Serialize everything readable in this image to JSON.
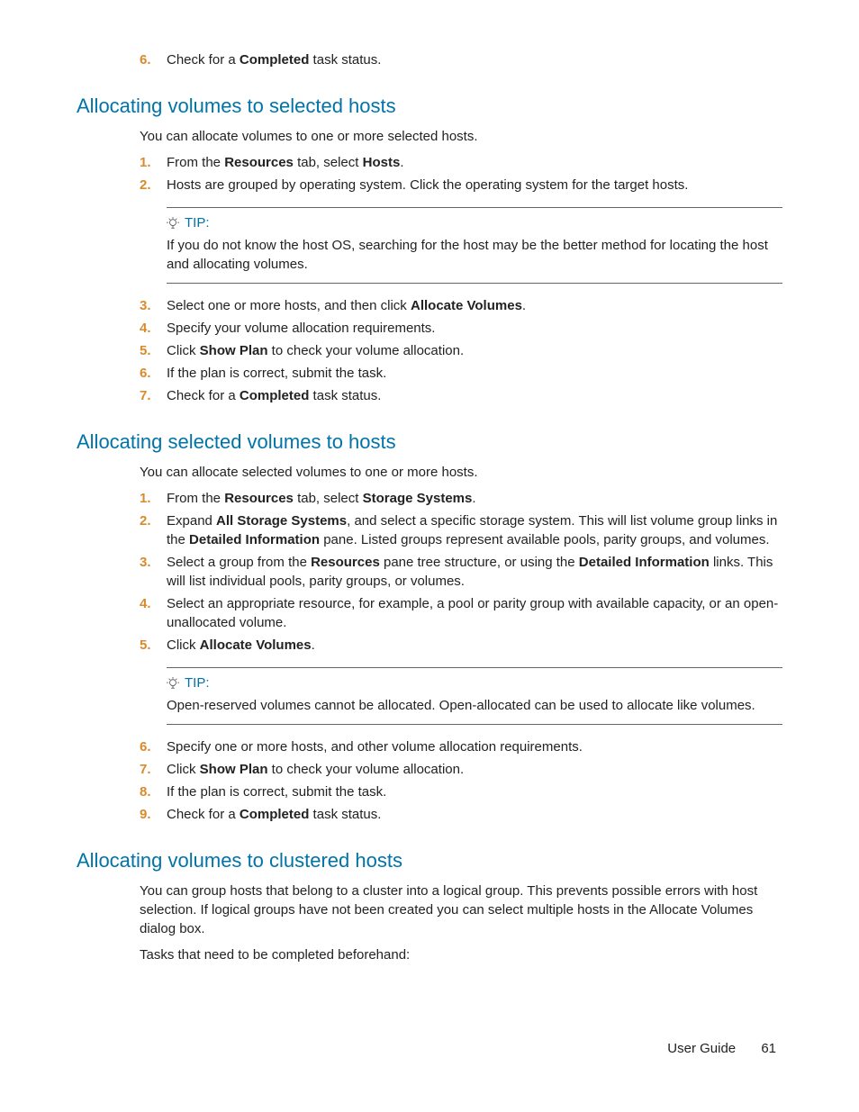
{
  "intro_step": {
    "num": "6.",
    "pre": "Check for a ",
    "bold": "Completed",
    "post": " task status."
  },
  "sec1": {
    "heading": "Allocating volumes to selected hosts",
    "lead": "You can allocate volumes to one or more selected hosts.",
    "steps_a": [
      {
        "num": "1.",
        "pre": "From the ",
        "b1": "Resources",
        "mid": " tab, select ",
        "b2": "Hosts",
        "post": "."
      },
      {
        "num": "2.",
        "pre": "Hosts are grouped by operating system. Click the operating system for the target hosts."
      }
    ],
    "tip": {
      "label": "TIP:",
      "body": "If you do not know the host OS, searching for the host may be the better method for locating the host and allocating volumes."
    },
    "steps_b": [
      {
        "num": "3.",
        "pre": "Select one or more hosts, and then click ",
        "b1": "Allocate Volumes",
        "post": "."
      },
      {
        "num": "4.",
        "pre": "Specify your volume allocation requirements."
      },
      {
        "num": "5.",
        "pre": "Click ",
        "b1": "Show Plan",
        "post": " to check your volume allocation."
      },
      {
        "num": "6.",
        "pre": "If the plan is correct, submit the task."
      },
      {
        "num": "7.",
        "pre": "Check for a ",
        "b1": "Completed",
        "post": " task status."
      }
    ]
  },
  "sec2": {
    "heading": "Allocating selected volumes to hosts",
    "lead": "You can allocate selected volumes to one or more hosts.",
    "steps_a": [
      {
        "num": "1.",
        "pre": "From the ",
        "b1": "Resources",
        "mid": " tab, select ",
        "b2": "Storage Systems",
        "post": "."
      },
      {
        "num": "2.",
        "pre": "Expand ",
        "b1": "All Storage Systems",
        "mid": ", and select a specific storage system. This will list volume group links in the ",
        "b2": "Detailed Information",
        "post": " pane. Listed groups represent available pools, parity groups, and volumes."
      },
      {
        "num": "3.",
        "pre": "Select a group from the ",
        "b1": "Resources",
        "mid": " pane tree structure, or using the ",
        "b2": "Detailed Information",
        "post": " links. This will list individual pools, parity groups, or volumes."
      },
      {
        "num": "4.",
        "pre": "Select an appropriate resource, for example, a pool or parity group with available capacity, or an open-unallocated volume."
      },
      {
        "num": "5.",
        "pre": "Click ",
        "b1": "Allocate Volumes",
        "post": "."
      }
    ],
    "tip": {
      "label": "TIP:",
      "body": "Open-reserved volumes cannot be allocated. Open-allocated can be used to allocate like volumes."
    },
    "steps_b": [
      {
        "num": "6.",
        "pre": "Specify one or more hosts, and other volume allocation requirements."
      },
      {
        "num": "7.",
        "pre": "Click ",
        "b1": "Show Plan",
        "post": " to check your volume allocation."
      },
      {
        "num": "8.",
        "pre": "If the plan is correct, submit the task."
      },
      {
        "num": "9.",
        "pre": "Check for a ",
        "b1": "Completed",
        "post": " task status."
      }
    ]
  },
  "sec3": {
    "heading": "Allocating volumes to clustered hosts",
    "p1": "You can group hosts that belong to a cluster into a logical group. This prevents possible errors with host selection. If logical groups have not been created you can select multiple hosts in the Allocate Volumes dialog box.",
    "p2": "Tasks that need to be completed beforehand:"
  },
  "footer": {
    "label": "User Guide",
    "page": "61"
  }
}
